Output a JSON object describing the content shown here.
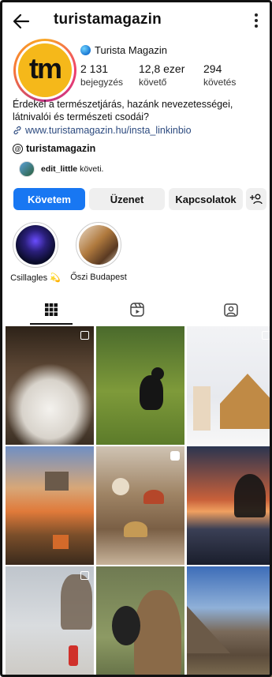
{
  "header": {
    "username": "turistamagazin",
    "back_icon": "arrow-left-icon",
    "menu_icon": "kebab-menu-icon"
  },
  "profile": {
    "avatar_text": "tm",
    "display_name": "Turista Magazin",
    "stats": [
      {
        "value": "2 131",
        "label": "bejegyzés"
      },
      {
        "value": "12,8 ezer",
        "label": "követő"
      },
      {
        "value": "294",
        "label": "követés"
      }
    ],
    "bio_line1": "Érdekel a természetjárás, hazánk nevezetességei,",
    "bio_line2": "látnivalói és természeti csodái?",
    "link": "www.turistamagazin.hu/insta_linkinbio",
    "threads_handle": "turistamagazin",
    "mutual_user": "edit_little",
    "mutual_text": "követi."
  },
  "actions": {
    "follow": "Követem",
    "message": "Üzenet",
    "contacts": "Kapcsolatok",
    "add_user_icon": "person-add-icon"
  },
  "highlights": [
    {
      "caption": "Csillagles 💫"
    },
    {
      "caption": "Őszi Budapest"
    }
  ],
  "tabs": [
    {
      "name": "grid-tab",
      "icon": "grid-icon",
      "active": true
    },
    {
      "name": "reels-tab",
      "icon": "reels-icon",
      "active": false
    },
    {
      "name": "tagged-tab",
      "icon": "tagged-icon",
      "active": false
    }
  ],
  "colors": {
    "primary_button": "#1877f2",
    "link": "#2c4a7f"
  }
}
